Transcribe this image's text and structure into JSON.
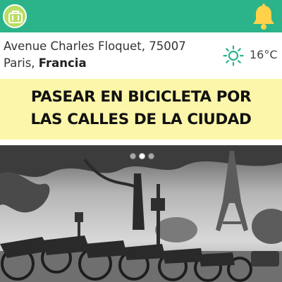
{
  "header": {
    "left_icon": "suitcase-icon",
    "right_icon": "bell-icon",
    "colors": {
      "bar": "#2bb38a",
      "button": "#b8de63",
      "bell": "#ffd24a"
    }
  },
  "location": {
    "address_line1": "Avenue Charles Floquet, 75007",
    "city": "Paris,",
    "country": "Francia",
    "weather_icon": "sun-icon",
    "temperature": "16°C"
  },
  "headline": {
    "line1": "PASEAR EN BICICLETA POR",
    "line2": "LAS CALLES DE LA CIUDAD",
    "background": "#fcf6aa"
  },
  "carousel": {
    "slide_count": 3,
    "active_index": 1,
    "image_subject": "bicycles-eiffel-tower-photo"
  }
}
